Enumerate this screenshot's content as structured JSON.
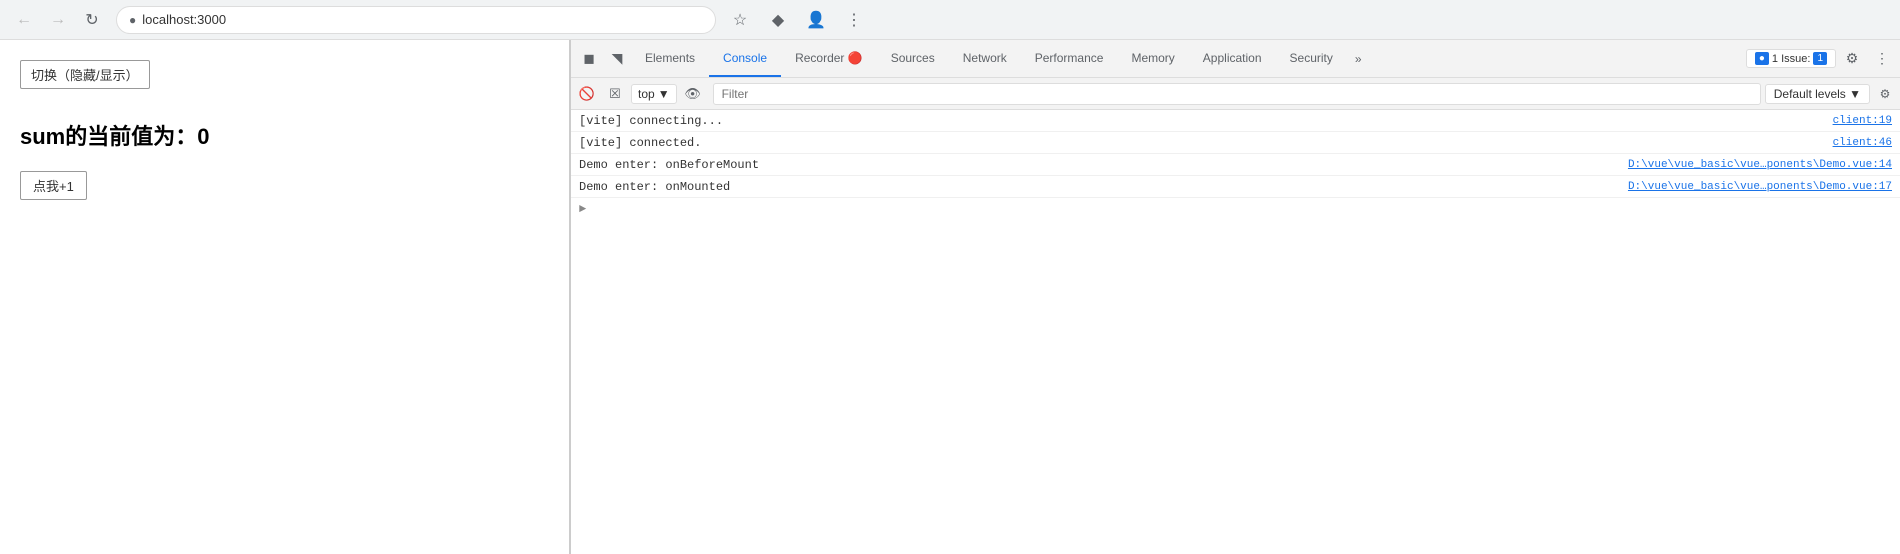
{
  "browser": {
    "url": "localhost:3000",
    "back_disabled": true,
    "forward_disabled": true
  },
  "page": {
    "toggle_btn_label": "切换（隐藏/显示）",
    "sum_display": "sum的当前值为：0",
    "click_btn_label": "点我+1"
  },
  "devtools": {
    "tabs": [
      {
        "id": "elements",
        "label": "Elements",
        "active": false
      },
      {
        "id": "console",
        "label": "Console",
        "active": true
      },
      {
        "id": "recorder",
        "label": "Recorder 🔴",
        "active": false
      },
      {
        "id": "sources",
        "label": "Sources",
        "active": false
      },
      {
        "id": "network",
        "label": "Network",
        "active": false
      },
      {
        "id": "performance",
        "label": "Performance",
        "active": false
      },
      {
        "id": "memory",
        "label": "Memory",
        "active": false
      },
      {
        "id": "application",
        "label": "Application",
        "active": false
      },
      {
        "id": "security",
        "label": "Security",
        "active": false
      }
    ],
    "more_label": "»",
    "issues_label": "1 Issue:",
    "issues_count": "1",
    "console_toolbar": {
      "top_label": "top",
      "filter_placeholder": "Filter",
      "default_levels_label": "Default levels ▼"
    },
    "console_lines": [
      {
        "text": "[vite] connecting...",
        "source": "client:19",
        "indent": false
      },
      {
        "text": "[vite] connected.",
        "source": "client:46",
        "indent": false
      },
      {
        "text": "Demo enter:  onBeforeMount",
        "source": "D:\\vue\\vue_basic\\vue…ponents\\Demo.vue:14",
        "indent": false
      },
      {
        "text": "Demo enter:  onMounted",
        "source": "D:\\vue\\vue_basic\\vue…ponents\\Demo.vue:17",
        "indent": false
      }
    ]
  }
}
